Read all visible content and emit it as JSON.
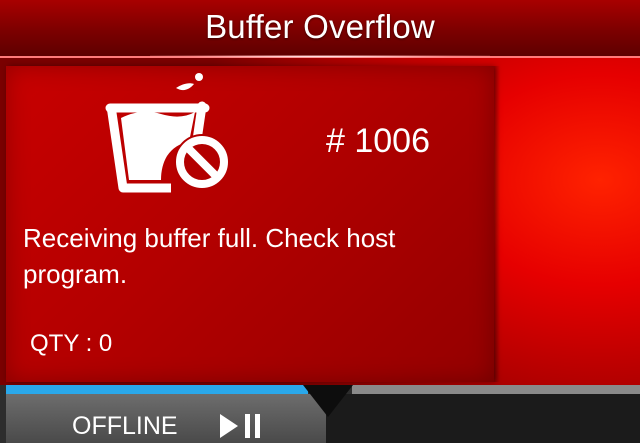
{
  "header": {
    "title": "Buffer Overflow"
  },
  "error": {
    "icon": "buffer-overflow-icon",
    "code": "# 1006",
    "message": "Receiving buffer full. Check host program.",
    "qty_label": "QTY",
    "qty_separator": " : ",
    "qty_value": "0"
  },
  "status": {
    "text": "OFFLINE",
    "play_pause_icon": "play-pause-icon"
  },
  "colors": {
    "background_red": "#e60000",
    "panel_red": "#b30000",
    "progress_blue": "#2aa8ea",
    "status_bar": "#4a4a4a"
  }
}
